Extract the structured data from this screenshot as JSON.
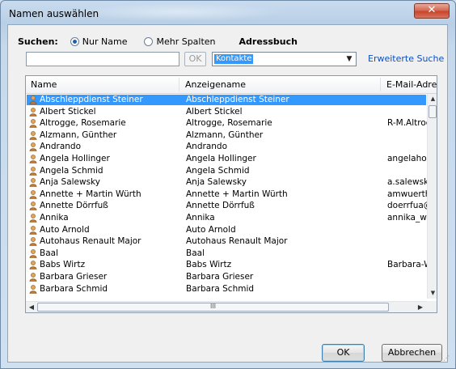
{
  "window": {
    "title": "Namen auswählen",
    "close_glyph": "✕"
  },
  "search": {
    "label": "Suchen:",
    "option_name": "Nur Name",
    "option_more": "Mehr Spalten",
    "addressbook_label": "Adressbuch",
    "input_value": "",
    "go_label": "OK",
    "addressbook_value": "Kontakte",
    "advanced_link": "Erweiterte Suche"
  },
  "list": {
    "columns": [
      "Name",
      "Anzeigename",
      "E-Mail-Adresse"
    ],
    "rows": [
      [
        "Abschleppdienst Steiner",
        "Abschleppdienst Steiner",
        ""
      ],
      [
        "Albert Stickel",
        "Albert Stickel",
        ""
      ],
      [
        "Altrogge, Rosemarie",
        "Altrogge, Rosemarie",
        "R-M.Altrogg"
      ],
      [
        "Alzmann, Günther",
        "Alzmann, Günther",
        ""
      ],
      [
        "Andrando",
        "Andrando",
        ""
      ],
      [
        "Angela Hollinger",
        "Angela Hollinger",
        "angelahollin"
      ],
      [
        "Angela Schmid",
        "Angela Schmid",
        ""
      ],
      [
        "Anja Salewsky",
        "Anja Salewsky",
        "a.salewsky("
      ],
      [
        "Annette + Martin Würth",
        "Annette + Martin Würth",
        "amwuerth@"
      ],
      [
        "Annette Dörrfuß",
        "Annette Dörrfuß",
        "doerrfua@t"
      ],
      [
        "Annika",
        "Annika",
        "annika_waç"
      ],
      [
        "Auto Arnold",
        "Auto Arnold",
        ""
      ],
      [
        "Autohaus Renault Major",
        "Autohaus Renault Major",
        ""
      ],
      [
        "Baal",
        "Baal",
        ""
      ],
      [
        "Babs Wirtz",
        "Babs Wirtz",
        "Barbara-Wi"
      ],
      [
        "Barbara Grieser",
        "Barbara Grieser",
        ""
      ],
      [
        "Barbara Schmid",
        "Barbara Schmid",
        ""
      ]
    ],
    "selected_index": 0,
    "hscroll_grip": "III"
  },
  "buttons": {
    "ok": "OK",
    "cancel": "Abbrechen"
  },
  "colors": {
    "selection": "#3399ff",
    "link": "#0d4fbf",
    "close": "#c7452c"
  },
  "icons": {
    "contact": "person-icon"
  }
}
